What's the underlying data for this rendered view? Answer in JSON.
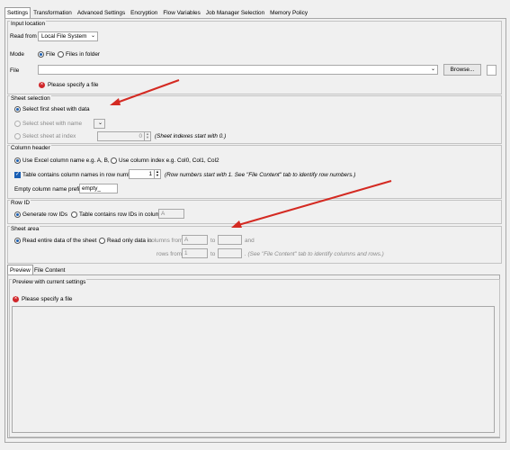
{
  "tabs": [
    "Settings",
    "Transformation",
    "Advanced Settings",
    "Encryption",
    "Flow Variables",
    "Job Manager Selection",
    "Memory Policy"
  ],
  "input_location": {
    "title": "Input location",
    "read_from_label": "Read from",
    "read_from_value": "Local File System",
    "mode_label": "Mode",
    "mode_file": "File",
    "mode_files_in_folder": "Files in folder",
    "file_label": "File",
    "file_value": "",
    "browse_label": "Browse...",
    "error": "Please specify a file"
  },
  "sheet_selection": {
    "title": "Sheet selection",
    "opt_first": "Select first sheet with data",
    "opt_name": "Select sheet with name",
    "opt_index": "Select sheet at index",
    "index_value": "0",
    "index_hint": "(Sheet indexes start with 0.)"
  },
  "column_header": {
    "title": "Column header",
    "opt_excel": "Use Excel column name e.g. A, B, C",
    "opt_index": "Use column index e.g. Col0, Col1, Col2",
    "contains_names": "Table contains column names in row number",
    "row_number": "1",
    "row_hint": "(Row numbers start with 1. See \"File Content\" tab to identify row numbers.)",
    "empty_prefix_label": "Empty column name prefix:",
    "empty_prefix_value": "empty_"
  },
  "row_id": {
    "title": "Row ID",
    "opt_generate": "Generate row IDs",
    "opt_contains": "Table contains row IDs in column",
    "column_value": "A"
  },
  "sheet_area": {
    "title": "Sheet area",
    "opt_entire": "Read entire data of the sheet",
    "opt_only": "Read only data in",
    "columns_from": "columns from",
    "col_from_value": "A",
    "to": "to",
    "and": "and",
    "rows_from": "rows from",
    "row_from_value": "1",
    "hint": ". (See \"File Content\" tab to identify columns and rows.)"
  },
  "bottom_tabs": [
    "Preview",
    "File Content"
  ],
  "preview": {
    "title": "Preview with current settings",
    "error": "Please specify a file"
  },
  "colors": {
    "arrow": "#d42a22",
    "accent": "#1a5fb4",
    "error": "#d0262a"
  }
}
